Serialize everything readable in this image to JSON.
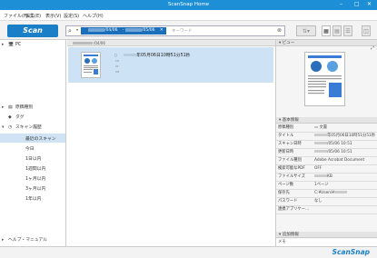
{
  "window": {
    "title": "ScanSnap Home",
    "minimize": "–",
    "maximize": "□",
    "close": "✕"
  },
  "menu": [
    "ファイル(F)",
    "編集(E)",
    "表示(V)",
    "設定(S)",
    "ヘルプ(H)"
  ],
  "toolbar": {
    "scan_label": "Scan",
    "search_icon": "search-icon",
    "search_dropdown": "▾",
    "date_from": "/04/06",
    "date_to": "/05/06",
    "date_close": "✕",
    "search_placeholder": "キーワード",
    "search_clear": "⊗"
  },
  "sidebar": {
    "pc_label": "PC",
    "items": [
      {
        "label": "原稿種別",
        "icon": "folder-icon"
      },
      {
        "label": "タグ",
        "icon": "tag-icon"
      },
      {
        "label": "スキャン履歴",
        "icon": "history-icon"
      }
    ],
    "history": [
      "最近のスキャン",
      "今日",
      "1日以内",
      "1週間以内",
      "1ヶ月以内",
      "3ヶ月以内",
      "1年以内"
    ],
    "help_manual": "ヘルプ・マニュアル"
  },
  "center": {
    "header_suffix": "/04/06",
    "document_title": "年05月06日10時51分51秒"
  },
  "right": {
    "preview_label": "ビュー",
    "basic_info_label": "基本情報",
    "props": [
      {
        "k": "原稿種別",
        "v": "文書"
      },
      {
        "k": "タイトル",
        "v": "年05月06日10時51分51秒"
      },
      {
        "k": "スキャン日時",
        "v": "/05/06 10:51"
      },
      {
        "k": "更新日時",
        "v": "/05/06 10:51"
      },
      {
        "k": "ファイル種別",
        "v": "Adobe Acrobat Document"
      },
      {
        "k": "検索可能なPDF",
        "v": "OFF"
      },
      {
        "k": "ファイルサイズ",
        "v": "KB"
      },
      {
        "k": "ページ数",
        "v": "1ページ"
      },
      {
        "k": "保存先",
        "v": "C:¥Users¥"
      },
      {
        "k": "パスワード",
        "v": "なし"
      },
      {
        "k": "連携アプリケー...",
        "v": ""
      }
    ],
    "additional_info_label": "追加情報",
    "memo_label": "メモ"
  },
  "status": {
    "brand": "ScanSnap"
  },
  "colors": {
    "accent": "#1b7fc7",
    "titlebar": "#1d8fd6",
    "selection": "#cde2f5"
  }
}
